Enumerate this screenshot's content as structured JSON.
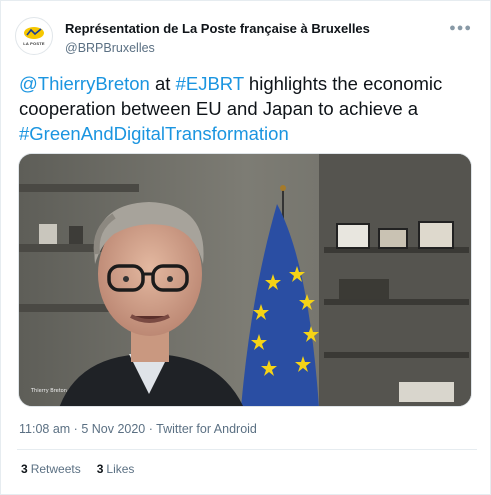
{
  "user": {
    "display_name": "Représentation de La Poste française à Bruxelles",
    "handle": "@BRPBruxelles",
    "avatar_text": "LA POSTE"
  },
  "tweet": {
    "mention": "@ThierryBreton",
    "text_1": " at ",
    "hashtag_1": "#EJBRT",
    "text_2": " highlights the economic cooperation between EU and Japan to achieve a ",
    "hashtag_2": "#GreenAndDigitalTransformation"
  },
  "media": {
    "caption": "Thierry Breton"
  },
  "meta": {
    "time": "11:08 am",
    "separator": " · ",
    "date": "5 Nov 2020",
    "source_sep": " · ",
    "source": "Twitter for Android"
  },
  "stats": {
    "retweets_count": "3",
    "retweets_label": "Retweets",
    "likes_count": "3",
    "likes_label": "Likes"
  },
  "colors": {
    "link": "#1b95e0",
    "secondary_text": "#5b7083",
    "la_poste_yellow": "#f6c700"
  }
}
